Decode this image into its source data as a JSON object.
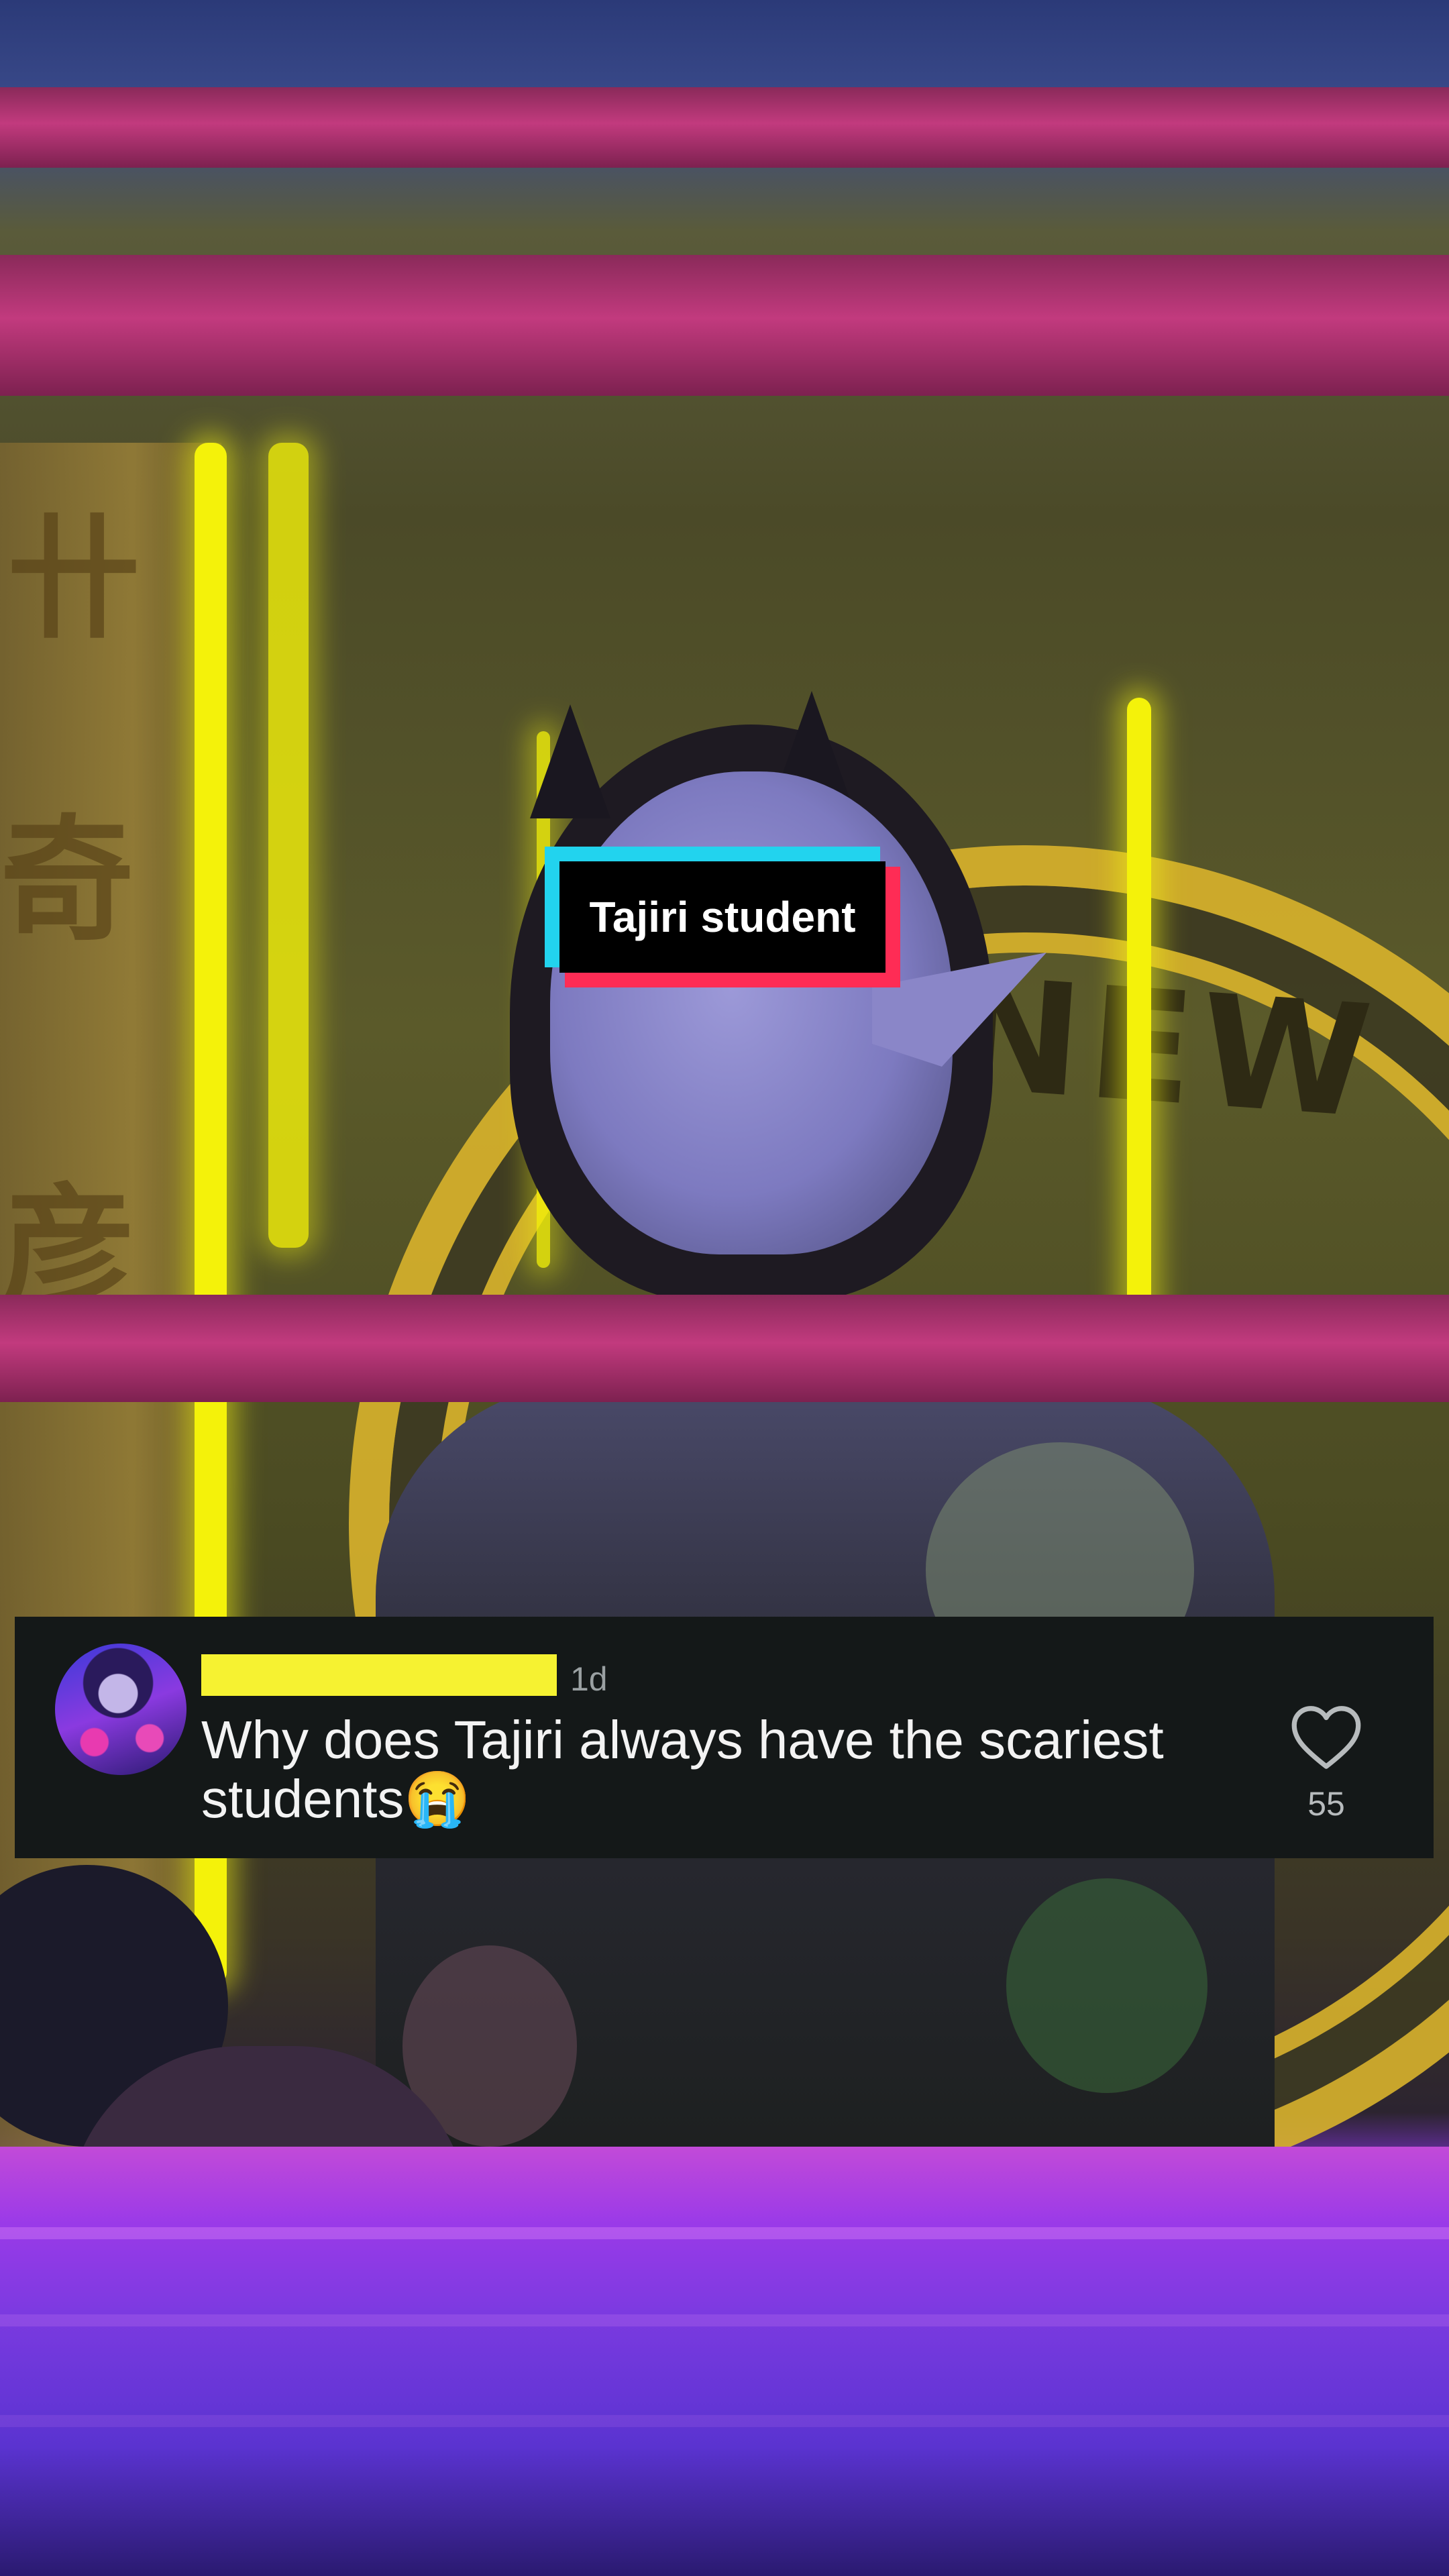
{
  "sticker": {
    "text": "Tajiri student"
  },
  "comment": {
    "username_redacted": true,
    "timestamp": "1d",
    "text": "Why does Tajiri always have the scariest students😭",
    "like_count": "55",
    "avatar": "user-avatar"
  },
  "background": {
    "scene": "wrestling-ring-stage",
    "signage_text": "NEW"
  },
  "colors": {
    "sticker_cyan": "#22d3ee",
    "sticker_pink": "#fe2c55",
    "sticker_bg": "#000000",
    "redaction_yellow": "#f6f231",
    "card_bg": "#141818"
  },
  "icons": {
    "like": "heart-outline-icon"
  }
}
